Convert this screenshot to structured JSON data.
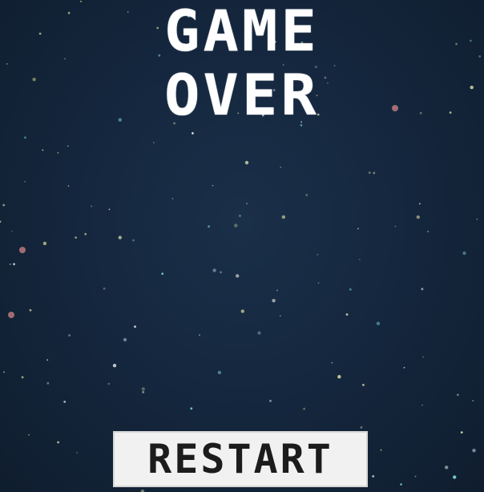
{
  "screen": {
    "title_line_1": "GAME",
    "title_line_2": "OVER",
    "restart_label": "RESTART"
  },
  "colors": {
    "background": "#142335",
    "title_text": "#ffffff",
    "button_background": "#f1f1f1",
    "button_text": "#1c1c1c"
  }
}
